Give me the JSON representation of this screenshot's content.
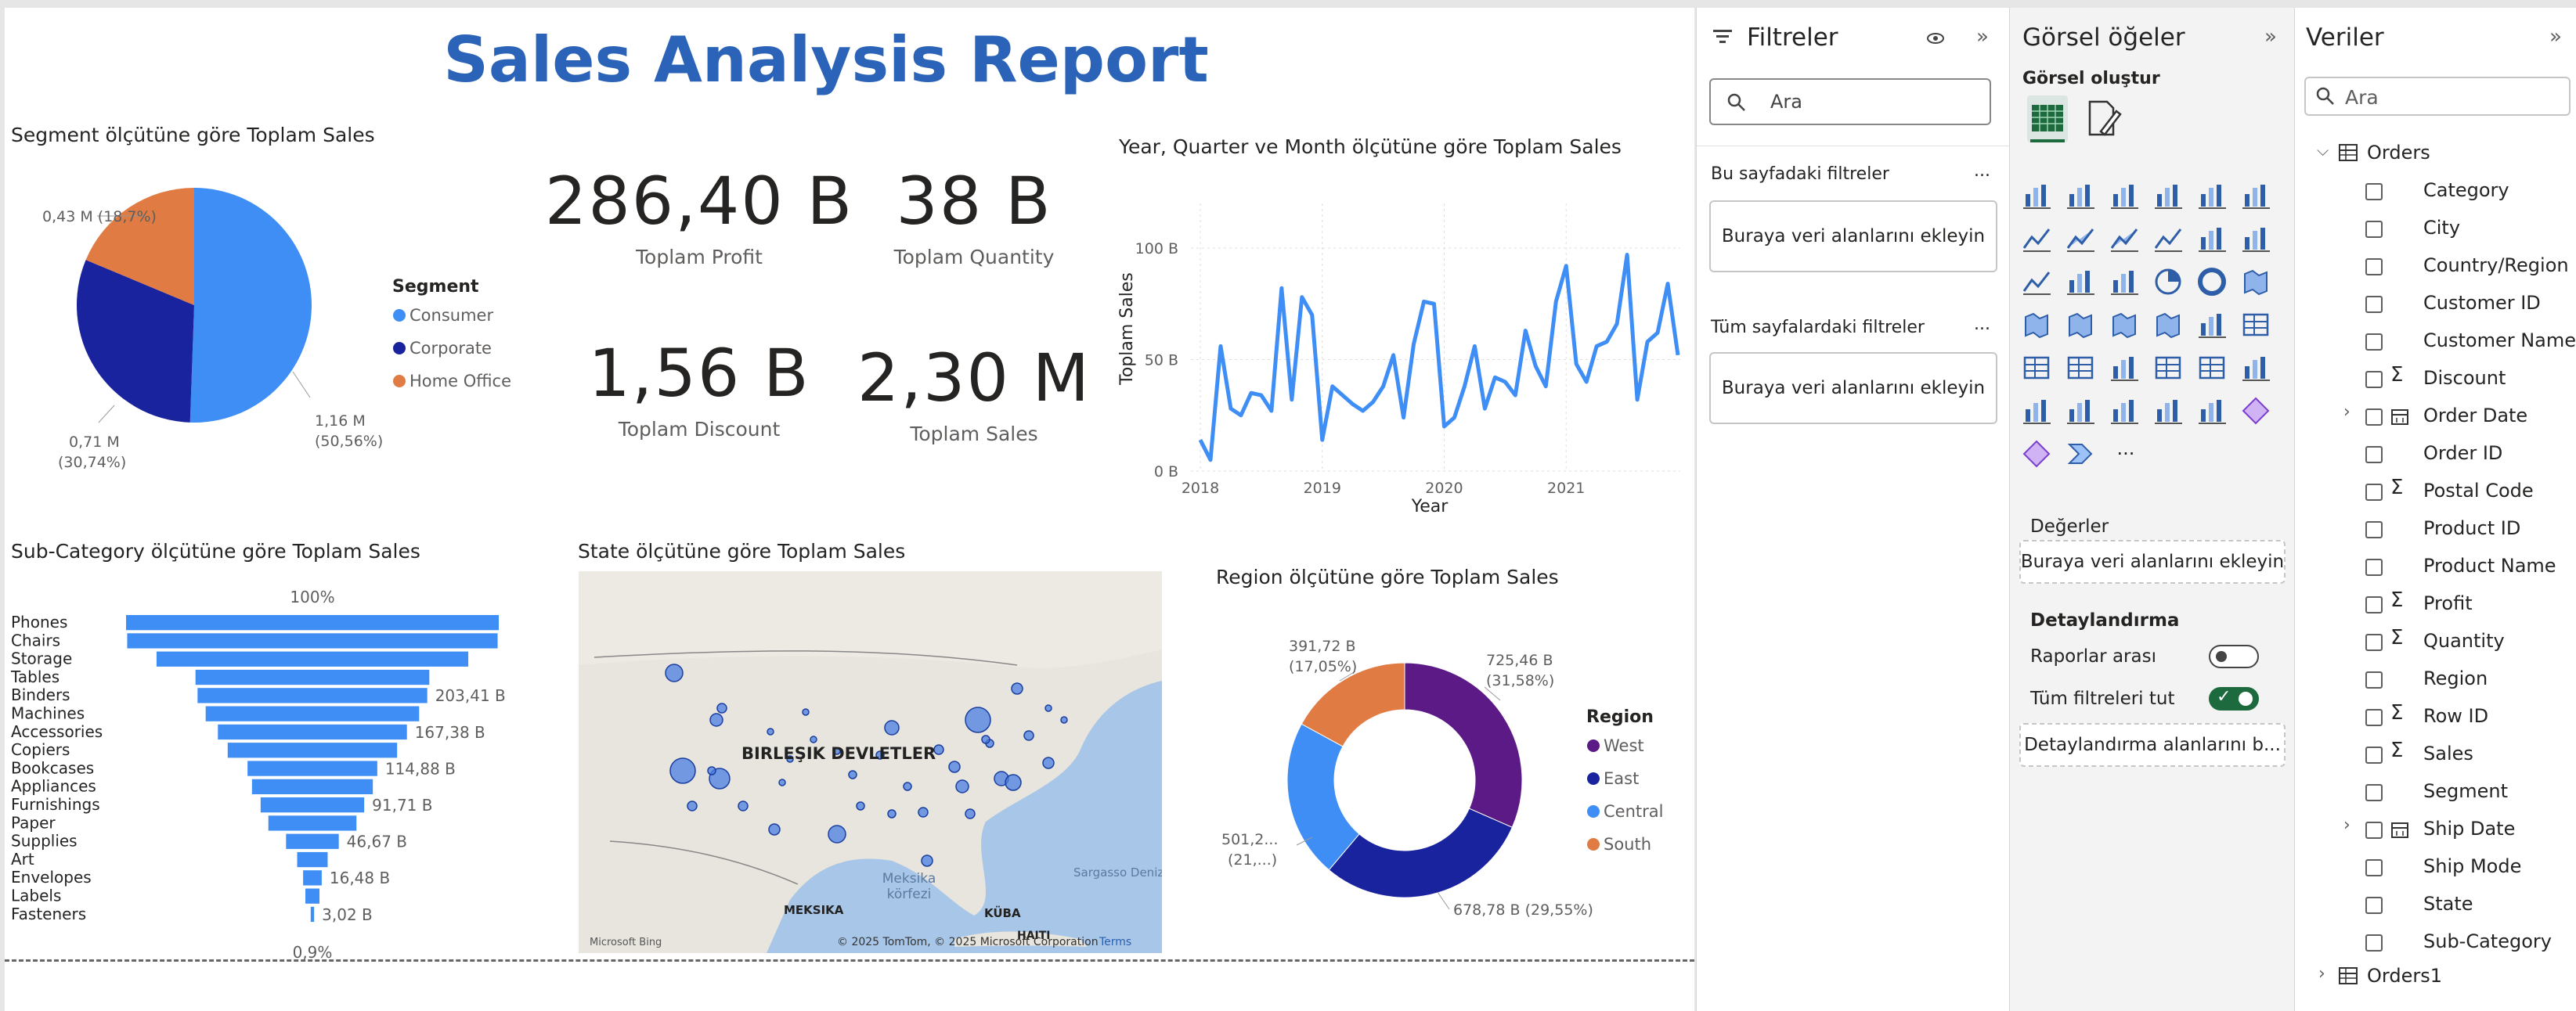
{
  "report": {
    "title": "Sales Analysis Report"
  },
  "segment_pie": {
    "title": "Segment ölçütüne göre Toplam Sales",
    "legend_title": "Segment",
    "slices": [
      {
        "name": "Consumer",
        "share": 50.56,
        "color": "#3f8ef5",
        "label1": "1,16 M",
        "label2": "(50,56%)"
      },
      {
        "name": "Corporate",
        "share": 30.74,
        "color": "#1a239e",
        "label1": "0,71 M",
        "label2": "(30,74%)"
      },
      {
        "name": "Home Office",
        "share": 18.7,
        "color": "#e07b44",
        "label1": "0,43 M (18,7%)",
        "label2": ""
      }
    ]
  },
  "cards": [
    {
      "value": "286,40 B",
      "label": "Toplam Profit"
    },
    {
      "value": "38 B",
      "label": "Toplam Quantity"
    },
    {
      "value": "1,56 B",
      "label": "Toplam Discount"
    },
    {
      "value": "2,30 M",
      "label": "Toplam Sales"
    }
  ],
  "line_chart": {
    "title": "Year, Quarter ve Month ölçütüne göre Toplam Sales",
    "xlabel": "Year",
    "ylabel": "Toplam Sales",
    "yticks": [
      "0 B",
      "50 B",
      "100 B"
    ],
    "xticks": [
      "2018",
      "2019",
      "2020",
      "2021"
    ],
    "chart_data": {
      "type": "line",
      "x_start": "2018-01",
      "x_step": "month",
      "ylim": [
        0,
        120
      ],
      "values": [
        14,
        5,
        56,
        28,
        25,
        35,
        34,
        27,
        82,
        32,
        78,
        70,
        14,
        38,
        34,
        30,
        27,
        31,
        38,
        52,
        24,
        57,
        76,
        75,
        20,
        24,
        38,
        56,
        28,
        42,
        40,
        34,
        63,
        47,
        38,
        76,
        92,
        48,
        40,
        56,
        58,
        66,
        97,
        32,
        58,
        62,
        84,
        52
      ]
    }
  },
  "funnel": {
    "title": "Sub-Category ölçütüne göre Toplam Sales",
    "top_label": "100%",
    "bottom_label": "0,9%",
    "chart_data": {
      "type": "bar",
      "categories": [
        "Phones",
        "Chairs",
        "Storage",
        "Tables",
        "Binders",
        "Machines",
        "Accessories",
        "Copiers",
        "Bookcases",
        "Appliances",
        "Furnishings",
        "Paper",
        "Supplies",
        "Art",
        "Envelopes",
        "Labels",
        "Fasteners"
      ],
      "values": [
        330,
        328,
        276,
        207,
        203.41,
        189,
        167.38,
        150,
        114.88,
        107,
        91.71,
        78,
        46.67,
        27,
        16.48,
        12.5,
        3.02
      ],
      "value_labels": [
        "",
        "",
        "",
        "",
        "203,41 B",
        "",
        "167,38 B",
        "",
        "114,88 B",
        "",
        "91,71 B",
        "",
        "46,67 B",
        "",
        "16,48 B",
        "",
        "3,02 B"
      ]
    }
  },
  "map": {
    "title": "State ölçütüne göre Toplam Sales",
    "country_label": "BIRLEŞIK DEVLETLER",
    "gulf_label1": "Meksika",
    "gulf_label2": "körfezi",
    "mexico_label": "MEKSIKA",
    "cuba_label": "KÜBA",
    "haiti_label": "HAITI",
    "sargasso_label": "Sargasso Denizi",
    "bing": "Microsoft Bing",
    "credit": "© 2025 TomTom, © 2025 Microsoft Corporation",
    "terms": "Terms"
  },
  "donut": {
    "title": "Region ölçütüne göre Toplam Sales",
    "legend_title": "Region",
    "chart_data": {
      "type": "pie",
      "slices": [
        {
          "name": "West",
          "share": 31.58,
          "color": "#5c1a87"
        },
        {
          "name": "East",
          "share": 29.55,
          "color": "#1a239e"
        },
        {
          "name": "Central",
          "share": 21.8,
          "color": "#3f8ef5"
        },
        {
          "name": "South",
          "share": 17.05,
          "color": "#e07b44"
        }
      ]
    },
    "labels": {
      "west1": "725,46 B",
      "west2": "(31,58%)",
      "east": "678,78 B (29,55%)",
      "central1": "501,2...",
      "central2": "(21,...)",
      "south1": "391,72 B",
      "south2": "(17,05%)"
    }
  },
  "filters": {
    "title": "Filtreler",
    "search_placeholder": "Ara",
    "page_filters": "Bu sayfadaki filtreler",
    "all_filters": "Tüm sayfalardaki filtreler",
    "drop_text": "Buraya veri alanlarını ekleyin",
    "more": "..."
  },
  "visuals": {
    "title": "Görsel öğeler",
    "build": "Görsel oluştur",
    "values": "Değerler",
    "values_drop": "Buraya veri alanlarını ekleyin",
    "drill": "Detaylandırma",
    "cross_report": "Raporlar arası",
    "keep_filters": "Tüm filtreleri tut",
    "drill_drop": "Detaylandırma alanlarını b...",
    "more": "···"
  },
  "data": {
    "title": "Veriler",
    "search_placeholder": "Ara",
    "table": "Orders",
    "table2": "Orders1",
    "fields": [
      {
        "name": "Category",
        "sigma": false,
        "icon": ""
      },
      {
        "name": "City",
        "sigma": false,
        "icon": ""
      },
      {
        "name": "Country/Region",
        "sigma": false,
        "icon": ""
      },
      {
        "name": "Customer ID",
        "sigma": false,
        "icon": ""
      },
      {
        "name": "Customer Name",
        "sigma": false,
        "icon": ""
      },
      {
        "name": "Discount",
        "sigma": true,
        "icon": ""
      },
      {
        "name": "Order Date",
        "sigma": false,
        "icon": "calendar"
      },
      {
        "name": "Order ID",
        "sigma": false,
        "icon": ""
      },
      {
        "name": "Postal Code",
        "sigma": true,
        "icon": ""
      },
      {
        "name": "Product ID",
        "sigma": false,
        "icon": ""
      },
      {
        "name": "Product Name",
        "sigma": false,
        "icon": ""
      },
      {
        "name": "Profit",
        "sigma": true,
        "icon": ""
      },
      {
        "name": "Quantity",
        "sigma": true,
        "icon": ""
      },
      {
        "name": "Region",
        "sigma": false,
        "icon": ""
      },
      {
        "name": "Row ID",
        "sigma": true,
        "icon": ""
      },
      {
        "name": "Sales",
        "sigma": true,
        "icon": ""
      },
      {
        "name": "Segment",
        "sigma": false,
        "icon": ""
      },
      {
        "name": "Ship Date",
        "sigma": false,
        "icon": "calendar"
      },
      {
        "name": "Ship Mode",
        "sigma": false,
        "icon": ""
      },
      {
        "name": "State",
        "sigma": false,
        "icon": ""
      },
      {
        "name": "Sub-Category",
        "sigma": false,
        "icon": ""
      }
    ]
  }
}
